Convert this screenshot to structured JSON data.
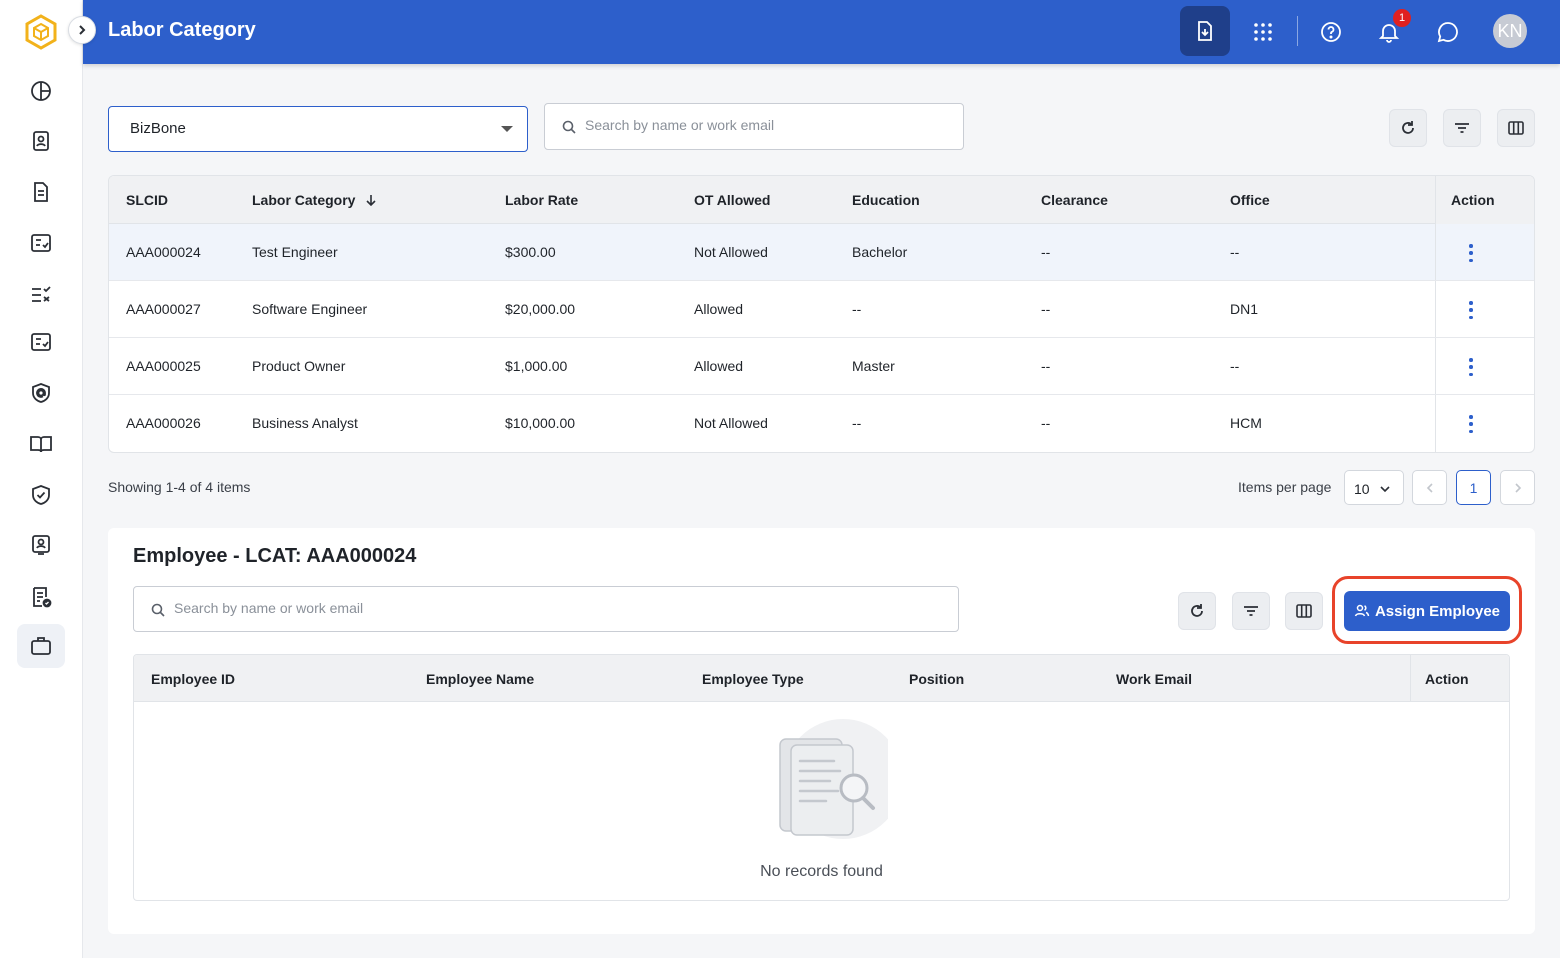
{
  "header": {
    "title": "Labor Category",
    "notification_count": "1",
    "avatar_initials": "KN"
  },
  "sidebar": {
    "items": [
      {
        "icon": "dashboard-icon"
      },
      {
        "icon": "contact-card-icon"
      },
      {
        "icon": "document-icon"
      },
      {
        "icon": "checklist-icon"
      },
      {
        "icon": "task-list-icon"
      },
      {
        "icon": "checklist-alt-icon"
      },
      {
        "icon": "at-shield-icon"
      },
      {
        "icon": "book-icon"
      },
      {
        "icon": "shield-check-icon"
      },
      {
        "icon": "badge-icon"
      },
      {
        "icon": "report-check-icon"
      },
      {
        "icon": "briefcase-icon",
        "active": true
      }
    ]
  },
  "filters": {
    "company": "BizBone",
    "search_placeholder": "Search by name or work email"
  },
  "labor_table": {
    "columns": [
      "SLCID",
      "Labor Category",
      "Labor Rate",
      "OT Allowed",
      "Education",
      "Clearance",
      "Office",
      "Action"
    ],
    "rows": [
      {
        "slcid": "AAA000024",
        "category": "Test Engineer",
        "rate": "$300.00",
        "ot": "Not Allowed",
        "education": "Bachelor",
        "clearance": "--",
        "office": "--"
      },
      {
        "slcid": "AAA000027",
        "category": "Software Engineer",
        "rate": "$20,000.00",
        "ot": "Allowed",
        "education": "--",
        "clearance": "--",
        "office": "DN1"
      },
      {
        "slcid": "AAA000025",
        "category": "Product Owner",
        "rate": "$1,000.00",
        "ot": "Allowed",
        "education": "Master",
        "clearance": "--",
        "office": "--"
      },
      {
        "slcid": "AAA000026",
        "category": "Business Analyst",
        "rate": "$10,000.00",
        "ot": "Not Allowed",
        "education": "--",
        "clearance": "--",
        "office": "HCM"
      }
    ]
  },
  "pagination": {
    "showing": "Showing 1-4 of 4 items",
    "items_per_page_label": "Items per page",
    "items_per_page": "10",
    "current_page": "1"
  },
  "employee_section": {
    "title": "Employee - LCAT: AAA000024",
    "search_placeholder": "Search by name or work email",
    "assign_label": "Assign Employee",
    "columns": [
      "Employee ID",
      "Employee Name",
      "Employee Type",
      "Position",
      "Work Email",
      "Action"
    ],
    "empty_text": "No records found"
  },
  "colors": {
    "brand": "#2d5fcb",
    "highlight": "#e8432a",
    "badge": "#e02020"
  }
}
